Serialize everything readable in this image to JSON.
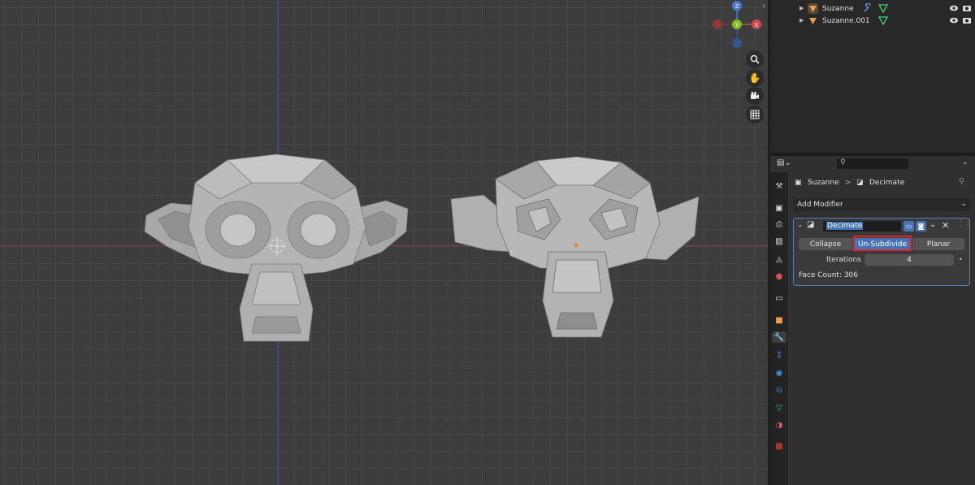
{
  "viewport": {
    "gizmo": {
      "z": "Z",
      "y": "Y",
      "x": "X"
    },
    "nav_icons": [
      "zoom-icon",
      "hand-pan-icon",
      "camera-icon",
      "grid-icon"
    ]
  },
  "outliner": {
    "rows": [
      {
        "name": "Suzanne"
      },
      {
        "name": "Suzanne.001"
      }
    ]
  },
  "properties": {
    "editor_type_icon": "properties-icon",
    "breadcrumb": {
      "object": "Suzanne",
      "separator": ">",
      "modifier": "Decimate"
    },
    "add_modifier": "Add Modifier",
    "modifier": {
      "name": "Decimate",
      "modes": [
        "Collapse",
        "Un-Subdivide",
        "Planar"
      ],
      "active_mode": "Un-Subdivide",
      "iterations_label": "Iterations",
      "iterations_value": "4",
      "face_count": "Face Count: 306"
    }
  },
  "colors": {
    "accent": "#4772b3",
    "highlight": "#e0242f",
    "panel_border": "#5680c2"
  }
}
